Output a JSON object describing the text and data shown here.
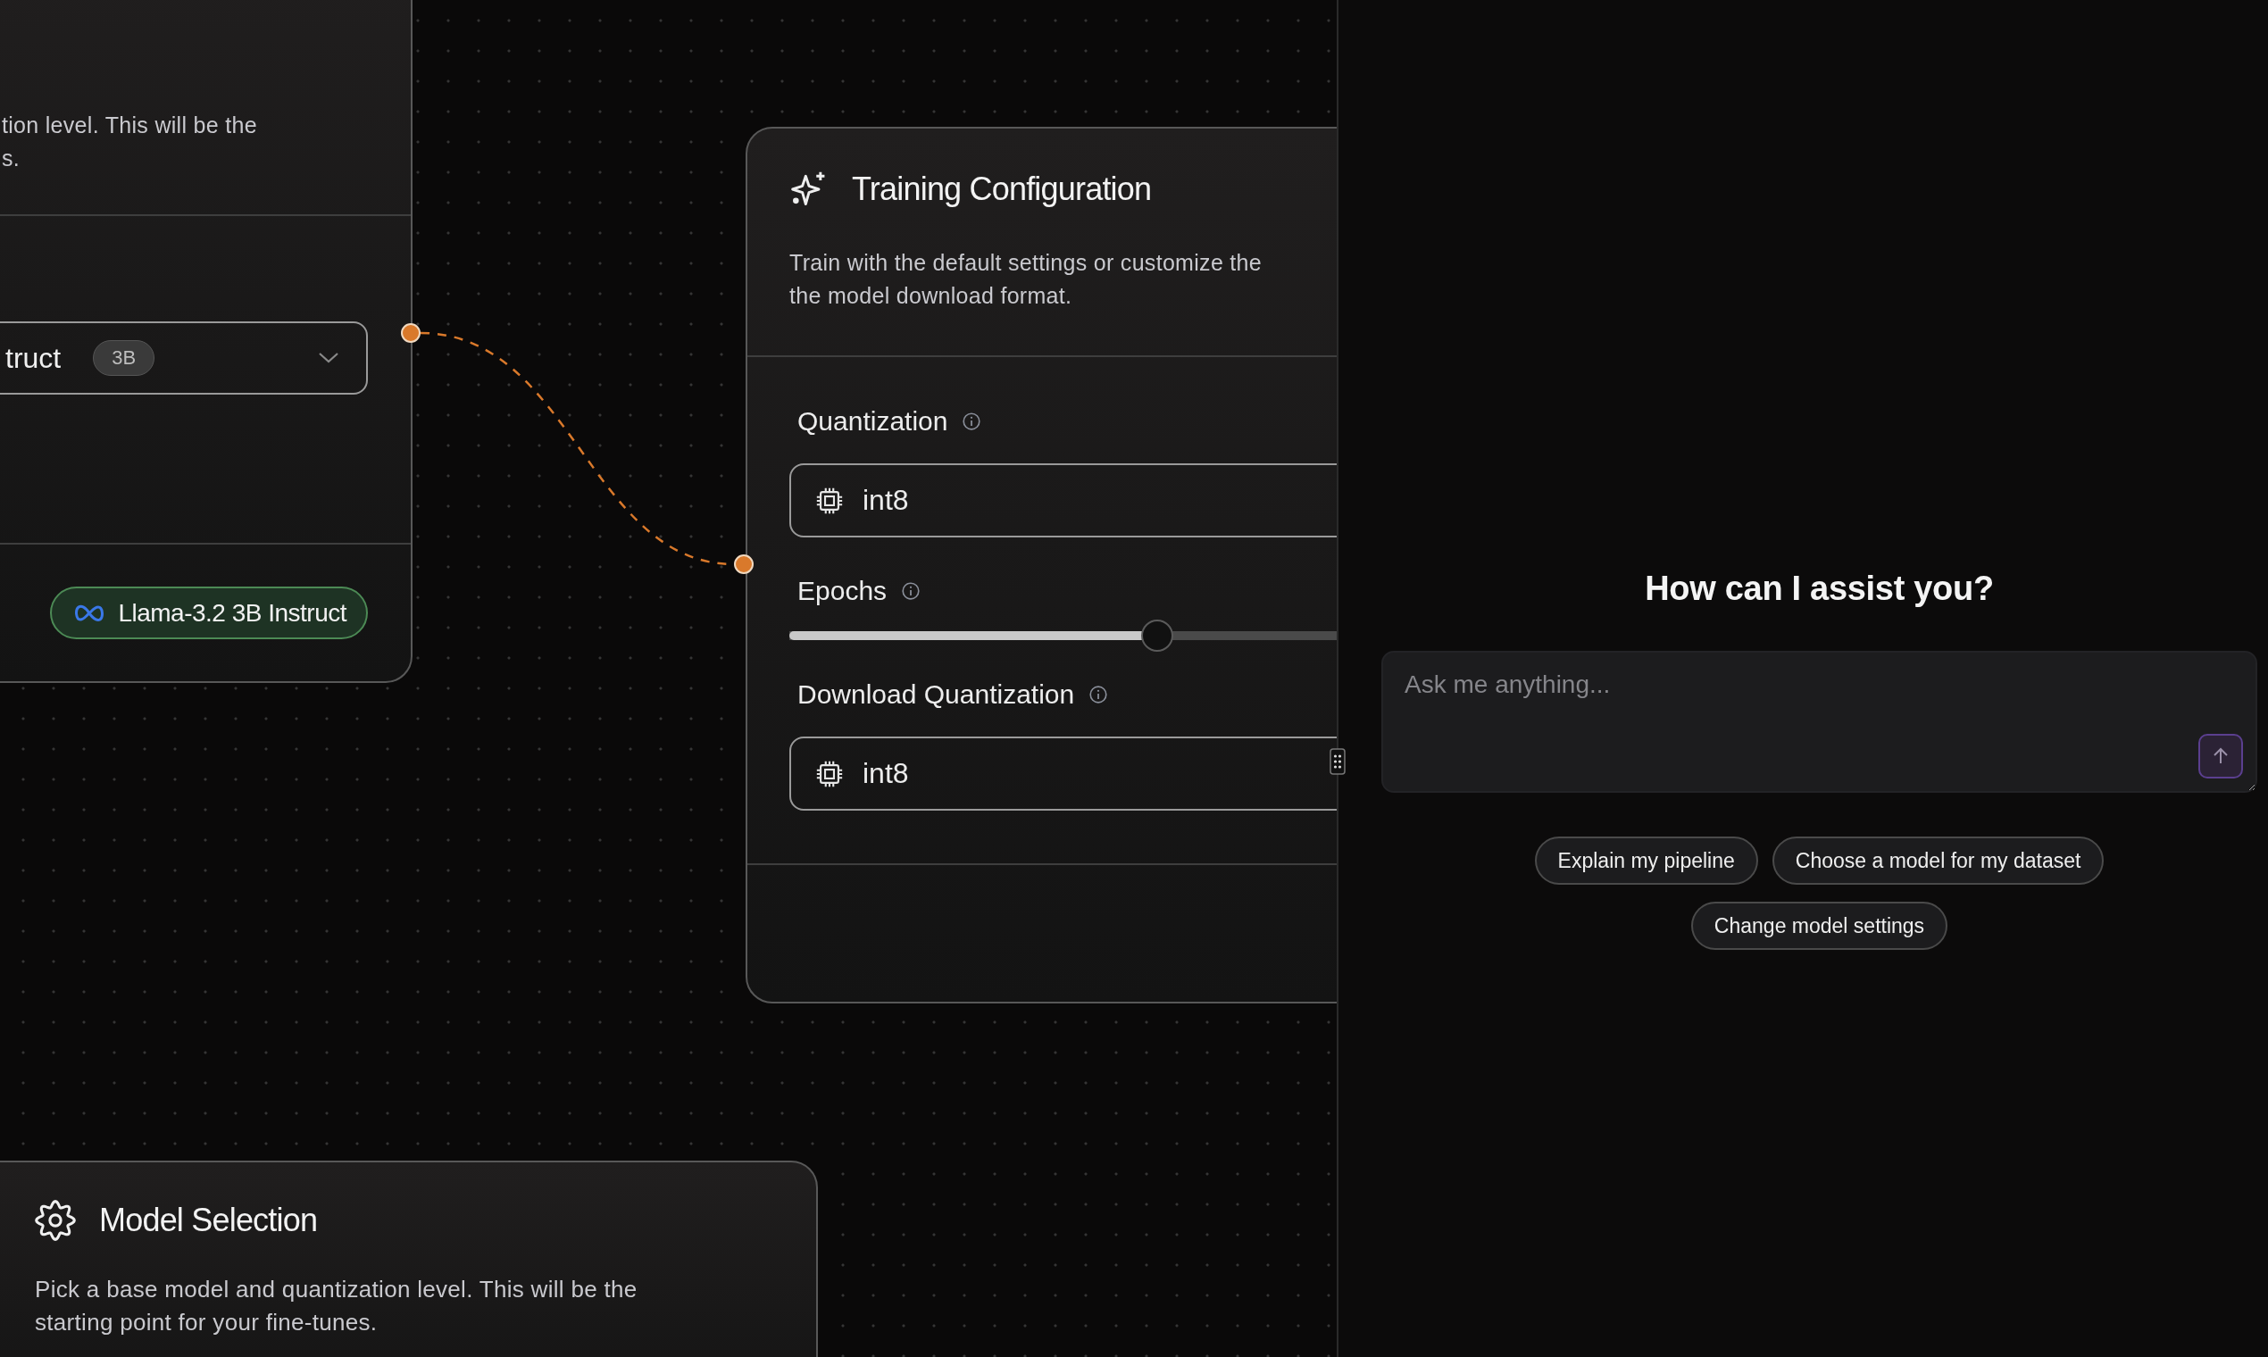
{
  "canvas": {
    "top_card": {
      "description_lines": [
        "tion level. This will be the",
        "s."
      ],
      "model_select": {
        "value": "truct",
        "badge": "3B"
      },
      "selected_model": "Llama-3.2 3B Instruct"
    },
    "training_card": {
      "title": "Training Configuration",
      "description_lines": [
        "Train with the default settings or customize the",
        "the model download format."
      ],
      "fields": [
        {
          "kind": "select",
          "label": "Quantization",
          "value": "int8"
        },
        {
          "kind": "slider",
          "label": "Epochs",
          "level": 0.67
        },
        {
          "kind": "select",
          "label": "Download Quantization",
          "value": "int8"
        }
      ]
    },
    "bottom_card": {
      "title": "Model Selection",
      "description_lines": [
        "Pick a base model and quantization level. This will be the",
        "starting point for your fine-tunes."
      ]
    }
  },
  "assistant": {
    "heading": "How can I assist you?",
    "input": {
      "placeholder": "Ask me anything..."
    },
    "suggestions": [
      "Explain my pipeline",
      "Choose a model for my dataset",
      "Change model settings"
    ]
  }
}
